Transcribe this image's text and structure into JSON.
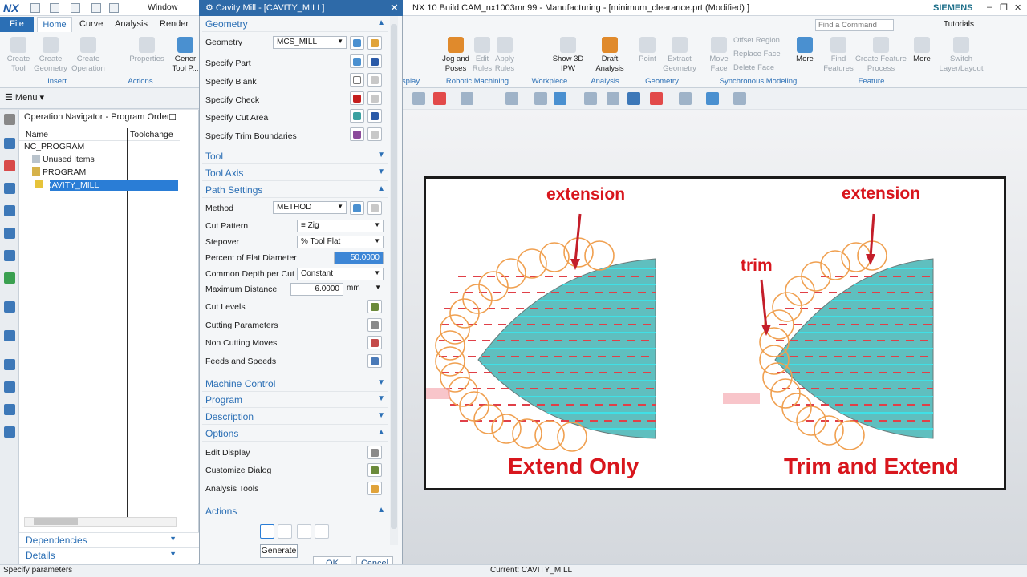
{
  "app": {
    "logo": "NX",
    "window_menu": "Window",
    "title": "NX 10  Build CAM_nx1003mr.99 - Manufacturing - [minimum_clearance.prt (Modified) ]",
    "brand": "SIEMENS"
  },
  "ribbon": {
    "file_tab": "File",
    "tabs": [
      "Home",
      "Curve",
      "Analysis",
      "Render"
    ],
    "find_placeholder": "Find a Command",
    "tutorials": "Tutorials",
    "left_buttons": [
      {
        "label": "Create Tool"
      },
      {
        "label": "Create Geometry"
      },
      {
        "label": "Create Operation"
      },
      {
        "label": "Properties"
      },
      {
        "label": "Gener Tool P..."
      }
    ],
    "left_groups": [
      "Insert",
      "Actions"
    ],
    "right_buttons": [
      {
        "label": "Jog and Poses"
      },
      {
        "label": "Edit Rules"
      },
      {
        "label": "Apply Rules"
      },
      {
        "label": "Show 3D IPW"
      },
      {
        "label": "Draft Analysis"
      },
      {
        "label": "Point"
      },
      {
        "label": "Extract Geometry"
      },
      {
        "label": "Move Face"
      },
      {
        "label": "Offset Region"
      },
      {
        "label": "Replace Face"
      },
      {
        "label": "Delete Face"
      },
      {
        "label": "More"
      },
      {
        "label": "Find Features"
      },
      {
        "label": "Create Feature Process"
      },
      {
        "label": "More"
      },
      {
        "label": "Switch Layer/Layout"
      }
    ],
    "right_groups": [
      "splay",
      "Robotic Machining",
      "Workpiece",
      "Analysis",
      "Geometry",
      "Synchronous Modeling",
      "Feature"
    ]
  },
  "toolbar": {
    "menu": "Menu"
  },
  "navigator": {
    "title": "Operation Navigator - Program Order",
    "columns": [
      "Name",
      "Toolchange"
    ],
    "tree": [
      {
        "label": "NC_PROGRAM"
      },
      {
        "label": "Unused Items"
      },
      {
        "label": "PROGRAM"
      },
      {
        "label": "CAVITY_MILL"
      }
    ],
    "sections": [
      "Dependencies",
      "Details"
    ]
  },
  "dialog": {
    "title": "Cavity Mill - [CAVITY_MILL]",
    "geometry": {
      "header": "Geometry",
      "geometry_label": "Geometry",
      "geometry_value": "MCS_MILL",
      "rows": [
        "Specify Part",
        "Specify Blank",
        "Specify Check",
        "Specify Cut Area",
        "Specify Trim Boundaries"
      ]
    },
    "collapsed_1": [
      "Tool",
      "Tool Axis"
    ],
    "path": {
      "header": "Path Settings",
      "method_label": "Method",
      "method_value": "METHOD",
      "cut_pattern_label": "Cut Pattern",
      "cut_pattern_value": "Zig",
      "stepover_label": "Stepover",
      "stepover_value": "% Tool Flat",
      "percent_label": "Percent of Flat Diameter",
      "percent_value": "50.0000",
      "depth_label": "Common Depth per Cut",
      "depth_value": "Constant",
      "maxdist_label": "Maximum Distance",
      "maxdist_value": "6.0000",
      "maxdist_unit": "mm",
      "rows": [
        "Cut Levels",
        "Cutting Parameters",
        "Non Cutting Moves",
        "Feeds and Speeds"
      ]
    },
    "collapsed_2": [
      "Machine Control",
      "Program",
      "Description"
    ],
    "options": {
      "header": "Options",
      "rows": [
        "Edit Display",
        "Customize Dialog",
        "Analysis Tools"
      ]
    },
    "actions": {
      "header": "Actions",
      "tooltip": "Generate"
    },
    "ok": "OK",
    "cancel": "Cancel"
  },
  "figure": {
    "left": {
      "extension": "extension",
      "caption": "Extend Only"
    },
    "right": {
      "extension": "extension",
      "trim": "trim",
      "caption": "Trim and Extend"
    }
  },
  "status": {
    "left": "Specify parameters",
    "current": "Current: CAVITY_MILL"
  },
  "colors": {
    "accent": "#2b6fb5",
    "selection": "#2a7dd6",
    "figure_red": "#d8161d",
    "teal": "#5fbfbf",
    "orange": "#f0a050"
  }
}
